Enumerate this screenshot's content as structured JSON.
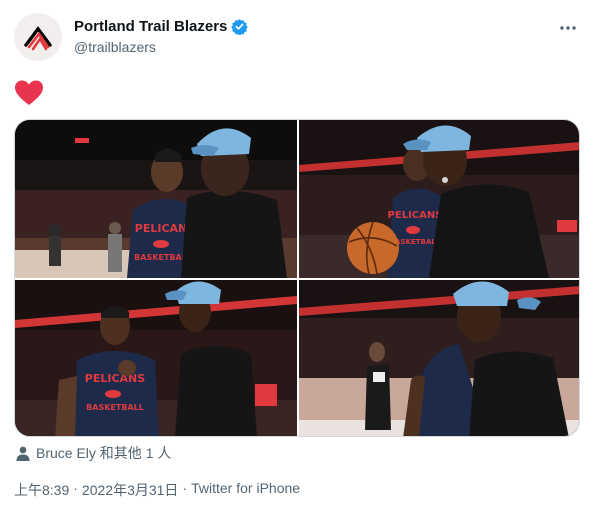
{
  "author": {
    "display_name": "Portland Trail Blazers",
    "handle": "@trailblazers",
    "verified": true,
    "avatar_icon": "trail-blazers-logo",
    "brand_color": "#e03a3e"
  },
  "more_icon": "more-dots-icon",
  "tweet": {
    "text_icon": "red-heart-emoji",
    "heart_color": "#e8344e"
  },
  "media": {
    "photos": [
      {
        "jersey": "PELICANS",
        "jersey_sub": "BASKETBALL"
      },
      {
        "jersey": "PELICANS",
        "jersey_sub": "BASKETBALL"
      },
      {
        "jersey": "PELICANS",
        "jersey_sub": "BASKETBALL"
      },
      {
        "jersey": "",
        "jersey_sub": ""
      }
    ]
  },
  "tagged": {
    "icon": "person-icon",
    "text": "Bruce Ely 和其他 1 人"
  },
  "meta": {
    "time": "上午8:39",
    "date": "2022年3月31日",
    "separator": "·",
    "source": "Twitter for iPhone"
  }
}
